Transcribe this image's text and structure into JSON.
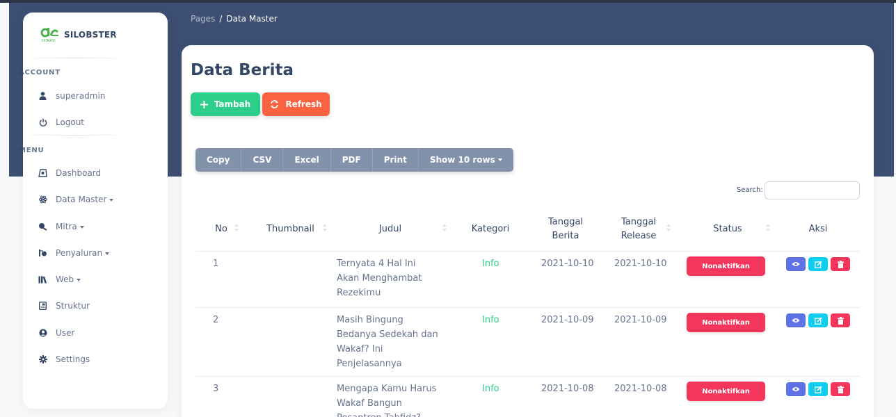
{
  "brand": {
    "name": "SILOBSTER",
    "logo_text": "DONASI"
  },
  "sidebar": {
    "account_heading": "ACCOUNT",
    "account_items": [
      {
        "label": "superadmin",
        "icon": "user-icon"
      },
      {
        "label": "Logout",
        "icon": "power-icon"
      }
    ],
    "menu_heading": "MENU",
    "menu_items": [
      {
        "label": "Dashboard",
        "icon": "dashboard-icon",
        "dropdown": false
      },
      {
        "label": "Data Master",
        "icon": "atom-icon",
        "dropdown": true
      },
      {
        "label": "Mitra",
        "icon": "handshake-icon",
        "dropdown": true
      },
      {
        "label": "Penyaluran",
        "icon": "donate-icon",
        "dropdown": true
      },
      {
        "label": "Web",
        "icon": "books-icon",
        "dropdown": true
      },
      {
        "label": "Struktur",
        "icon": "sitemap-icon",
        "dropdown": false
      },
      {
        "label": "User",
        "icon": "user-circle-icon",
        "dropdown": false
      },
      {
        "label": "Settings",
        "icon": "gear-icon",
        "dropdown": false
      }
    ]
  },
  "breadcrumb": {
    "parent": "Pages",
    "separator": "/",
    "current": "Data Master"
  },
  "page": {
    "title": "Data Berita"
  },
  "actions": {
    "add_label": "Tambah",
    "refresh_label": "Refresh"
  },
  "export_buttons": [
    "Copy",
    "CSV",
    "Excel",
    "PDF",
    "Print",
    "Show 10 rows"
  ],
  "search": {
    "label": "Search:",
    "value": ""
  },
  "table": {
    "headers": {
      "no": "No",
      "thumbnail": "Thumbnail",
      "judul": "Judul",
      "kategori": "Kategori",
      "tanggal_berita_1": "Tanggal",
      "tanggal_berita_2": "Berita",
      "tanggal_release_1": "Tanggal",
      "tanggal_release_2": "Release",
      "status": "Status",
      "aksi": "Aksi"
    },
    "rows": [
      {
        "no": "1",
        "judul_lines": [
          "Ternyata 4 Hal Ini",
          "Akan Menghambat",
          "Rezekimu"
        ],
        "kategori": "Info",
        "tanggal_berita": "2021-10-10",
        "tanggal_release": "2021-10-10",
        "status": "Nonaktifkan"
      },
      {
        "no": "2",
        "judul_lines": [
          "Masih Bingung",
          "Bedanya Sedekah dan",
          "Wakaf? Ini",
          "Penjelasannya"
        ],
        "kategori": "Info",
        "tanggal_berita": "2021-10-09",
        "tanggal_release": "2021-10-09",
        "status": "Nonaktifkan"
      },
      {
        "no": "3",
        "judul_lines": [
          "Mengapa Kamu Harus",
          "Wakaf Bangun",
          "Pesantren Tahfidz?"
        ],
        "kategori": "Info",
        "tanggal_berita": "2021-10-08",
        "tanggal_release": "2021-10-08",
        "status": "Nonaktifkan"
      }
    ]
  },
  "colors": {
    "header_bg": "#3c4f73",
    "success": "#2dce89",
    "warning": "#fb6340",
    "danger": "#f5365c",
    "primary": "#5e72e4",
    "info": "#11cdef",
    "secondary": "#8392ab"
  }
}
